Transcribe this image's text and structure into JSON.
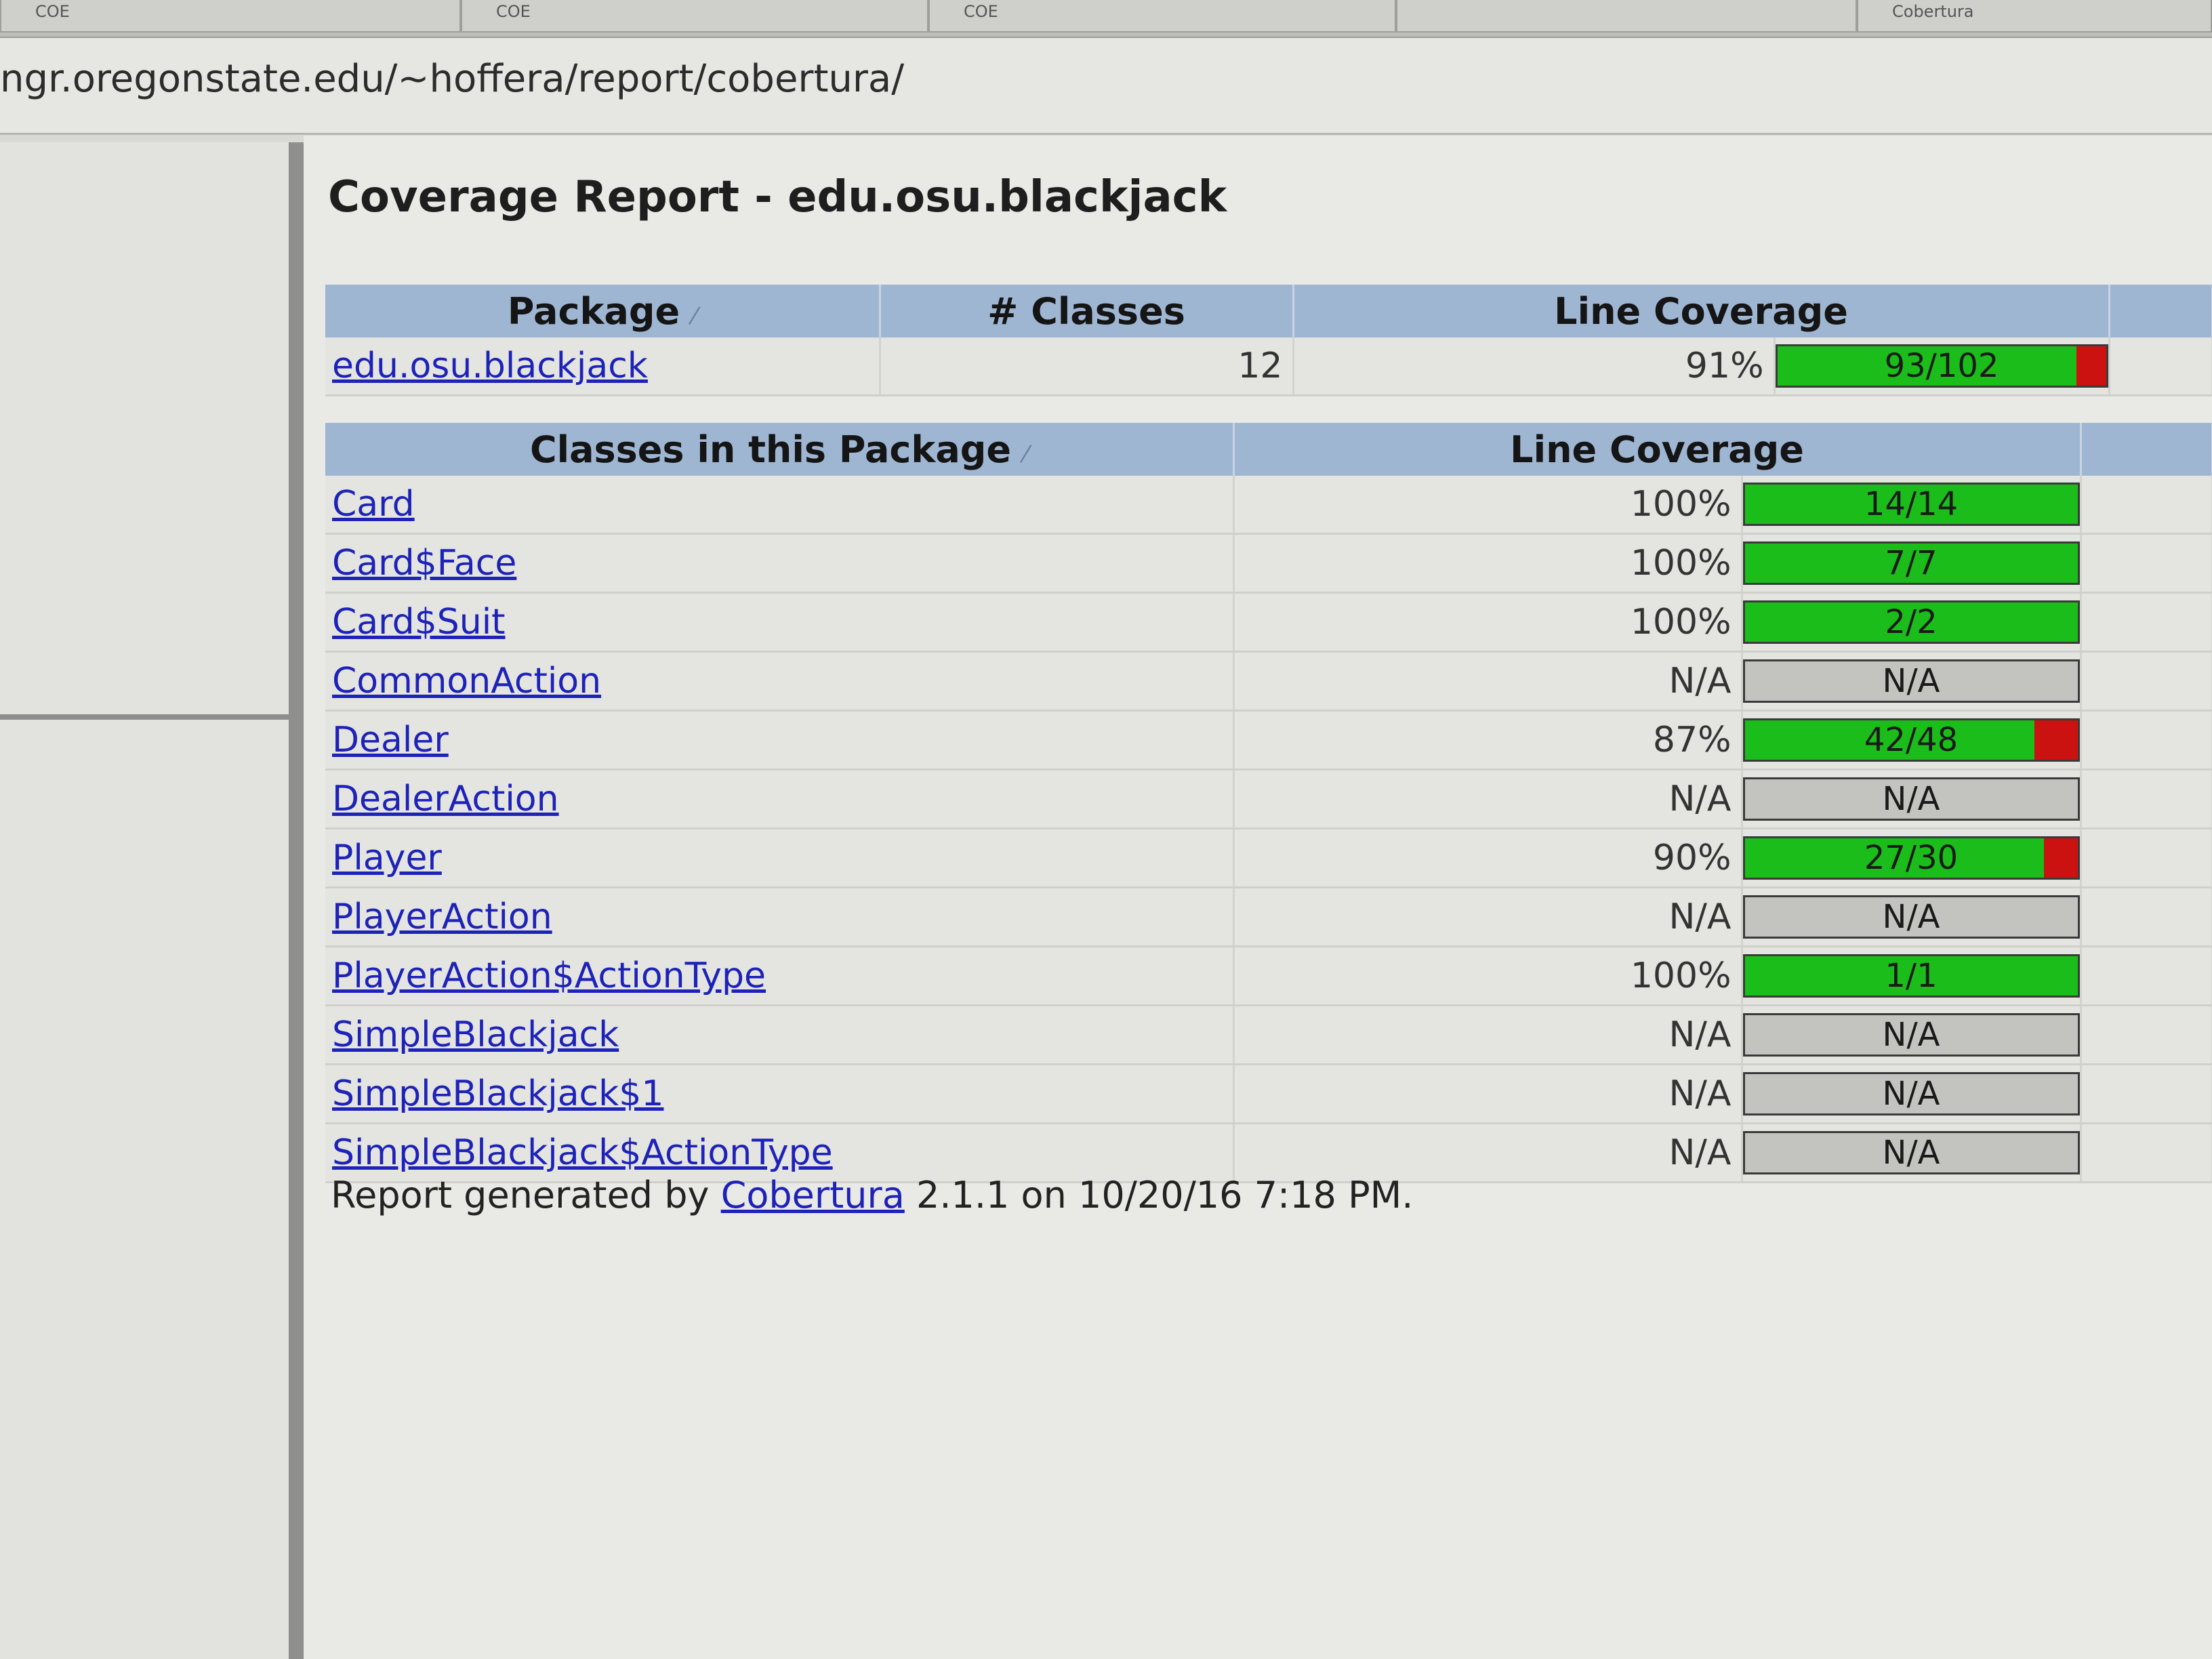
{
  "browser": {
    "tabs": [
      {
        "label": "COE"
      },
      {
        "label": "COE"
      },
      {
        "label": "COE"
      },
      {
        "label": ""
      },
      {
        "label": "Cobertura"
      }
    ],
    "url": "ngr.oregonstate.edu/~hoffera/report/cobertura/"
  },
  "report": {
    "title": "Coverage Report - edu.osu.blackjack",
    "package_table": {
      "headers": {
        "package": "Package",
        "classes": "# Classes",
        "line_coverage": "Line Coverage"
      },
      "row": {
        "name": "edu.osu.blackjack",
        "classes": "12",
        "percent": "91%",
        "ratio": "93/102",
        "coverage": 0.91
      }
    },
    "class_table": {
      "headers": {
        "classes": "Classes in this Package",
        "line_coverage": "Line Coverage"
      },
      "rows": [
        {
          "name": "Card",
          "percent": "100%",
          "ratio": "14/14",
          "coverage": 1.0
        },
        {
          "name": "Card$Face",
          "percent": "100%",
          "ratio": "7/7",
          "coverage": 1.0
        },
        {
          "name": "Card$Suit",
          "percent": "100%",
          "ratio": "2/2",
          "coverage": 1.0
        },
        {
          "name": "CommonAction",
          "percent": "N/A",
          "ratio": "N/A",
          "coverage": null
        },
        {
          "name": "Dealer",
          "percent": "87%",
          "ratio": "42/48",
          "coverage": 0.87
        },
        {
          "name": "DealerAction",
          "percent": "N/A",
          "ratio": "N/A",
          "coverage": null
        },
        {
          "name": "Player",
          "percent": "90%",
          "ratio": "27/30",
          "coverage": 0.9
        },
        {
          "name": "PlayerAction",
          "percent": "N/A",
          "ratio": "N/A",
          "coverage": null
        },
        {
          "name": "PlayerAction$ActionType",
          "percent": "100%",
          "ratio": "1/1",
          "coverage": 1.0
        },
        {
          "name": "SimpleBlackjack",
          "percent": "N/A",
          "ratio": "N/A",
          "coverage": null
        },
        {
          "name": "SimpleBlackjack$1",
          "percent": "N/A",
          "ratio": "N/A",
          "coverage": null
        },
        {
          "name": "SimpleBlackjack$ActionType",
          "percent": "N/A",
          "ratio": "N/A",
          "coverage": null
        }
      ]
    },
    "footer": {
      "prefix": "Report generated by",
      "link": "Cobertura",
      "suffix": "2.1.1 on 10/20/16 7:18 PM."
    }
  },
  "colors": {
    "covered": "#1bbd1b",
    "missed": "#cc1111",
    "header": "#9fb6d3",
    "link": "#1d22b8"
  }
}
